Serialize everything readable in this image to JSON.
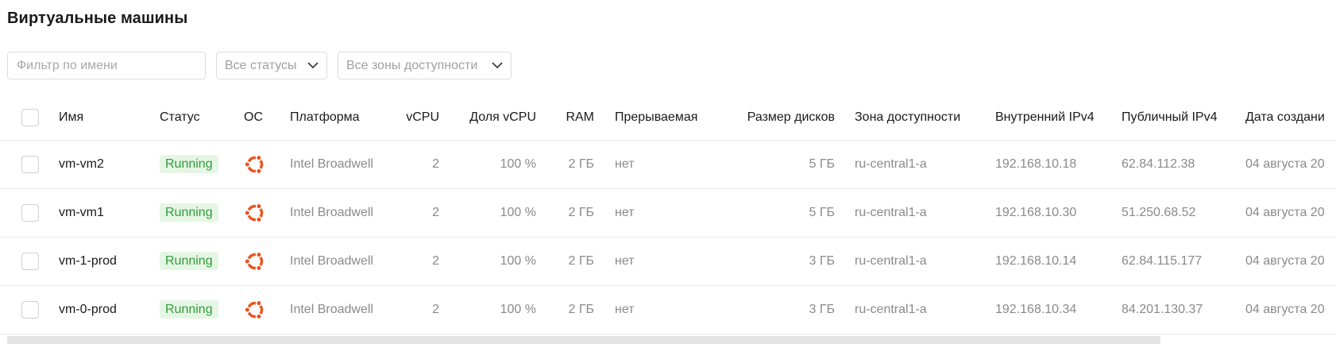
{
  "page_title": "Виртуальные машины",
  "filters": {
    "name_placeholder": "Фильтр по имени",
    "status_select": "Все статусы",
    "zone_select": "Все зоны доступности"
  },
  "columns": {
    "name": "Имя",
    "status": "Статус",
    "os": "ОС",
    "platform": "Платформа",
    "vcpu": "vCPU",
    "vcpu_share": "Доля vCPU",
    "ram": "RAM",
    "preemptible": "Прерываемая",
    "disk_size": "Размер дисков",
    "zone": "Зона доступности",
    "internal_ip": "Внутренний IPv4",
    "public_ip": "Публичный IPv4",
    "created": "Дата создани"
  },
  "rows": [
    {
      "name": "vm-vm2",
      "status": "Running",
      "os": "ubuntu-icon",
      "platform": "Intel Broadwell",
      "vcpu": "2",
      "vcpu_share": "100 %",
      "ram": "2 ГБ",
      "preemptible": "нет",
      "disk_size": "5 ГБ",
      "zone": "ru-central1-a",
      "internal_ip": "192.168.10.18",
      "public_ip": "62.84.112.38",
      "created": "04 августа 20"
    },
    {
      "name": "vm-vm1",
      "status": "Running",
      "os": "ubuntu-icon",
      "platform": "Intel Broadwell",
      "vcpu": "2",
      "vcpu_share": "100 %",
      "ram": "2 ГБ",
      "preemptible": "нет",
      "disk_size": "5 ГБ",
      "zone": "ru-central1-a",
      "internal_ip": "192.168.10.30",
      "public_ip": "51.250.68.52",
      "created": "04 августа 20"
    },
    {
      "name": "vm-1-prod",
      "status": "Running",
      "os": "ubuntu-icon",
      "platform": "Intel Broadwell",
      "vcpu": "2",
      "vcpu_share": "100 %",
      "ram": "2 ГБ",
      "preemptible": "нет",
      "disk_size": "3 ГБ",
      "zone": "ru-central1-a",
      "internal_ip": "192.168.10.14",
      "public_ip": "62.84.115.177",
      "created": "04 августа 20"
    },
    {
      "name": "vm-0-prod",
      "status": "Running",
      "os": "ubuntu-icon",
      "platform": "Intel Broadwell",
      "vcpu": "2",
      "vcpu_share": "100 %",
      "ram": "2 ГБ",
      "preemptible": "нет",
      "disk_size": "3 ГБ",
      "zone": "ru-central1-a",
      "internal_ip": "192.168.10.34",
      "public_ip": "84.201.130.37",
      "created": "04 августа 20"
    }
  ],
  "colors": {
    "status_running_bg": "#e6f6e4",
    "status_running_text": "#2f9e3a",
    "ubuntu_orange": "#e95420"
  }
}
